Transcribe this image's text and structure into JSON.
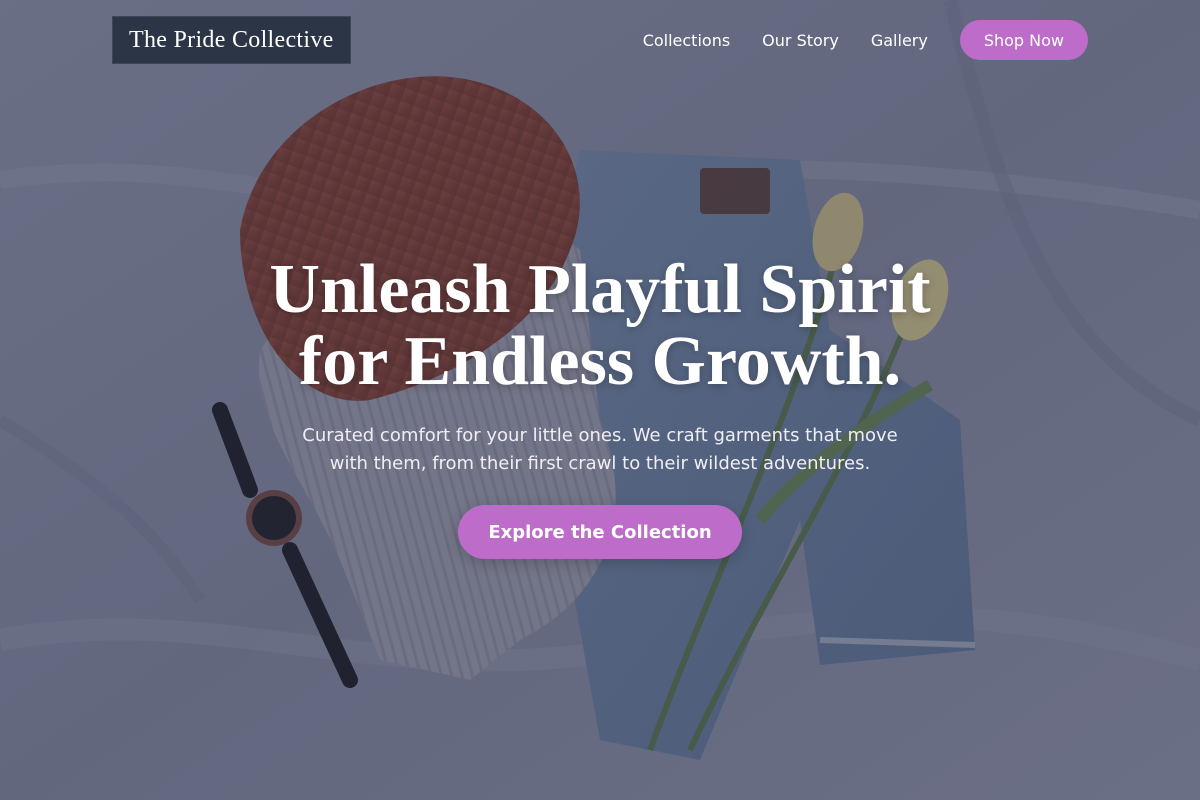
{
  "brand": {
    "name": "The Pride Collective"
  },
  "nav": {
    "links": [
      "Collections",
      "Our Story",
      "Gallery"
    ],
    "cta_label": "Shop Now"
  },
  "hero": {
    "title_line1": "Unleash Playful Spirit",
    "title_line2": "for Endless Growth.",
    "subtitle_line1": "Curated comfort for your little ones. We craft garments that move",
    "subtitle_line2": "with them, from their first crawl to their wildest adventures.",
    "cta_label": "Explore the Collection"
  },
  "colors": {
    "accent": "#bd6cc9",
    "logo_bg": "#2b3546",
    "text": "#ffffff"
  },
  "background": {
    "depicts": [
      "knit-beanie",
      "knit-sweater",
      "denim-jeans",
      "wristwatch",
      "yellow-tulips",
      "bedsheet"
    ]
  }
}
